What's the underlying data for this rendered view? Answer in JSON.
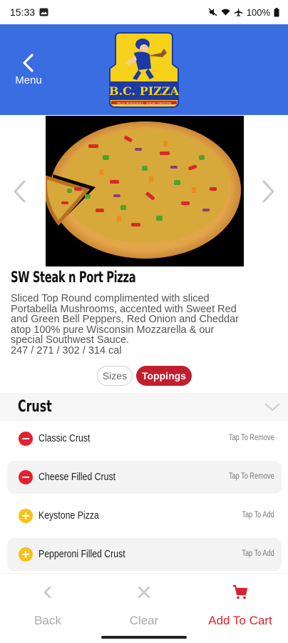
{
  "status_bar": {
    "time": "15:33",
    "battery": "100%"
  },
  "header": {
    "back_label": "Menu",
    "logo_text": "B.C. PIZZA",
    "logo_tagline": "FRESH INGREDIENTS · UNIQUE CREATIONS"
  },
  "product": {
    "title": "SW Steak n Port Pizza",
    "description": "Sliced Top Round complimented with sliced Portabella Mushrooms, accented with Sweet Red and Green Bell Peppers, Red Onion and Cheddar atop 100% pure Wisconsin Mozzarella & our special Southwest Sauce.",
    "calories": "247 / 271 / 302 / 314 cal"
  },
  "segments": {
    "sizes": "Sizes",
    "toppings": "Toppings",
    "selected": "Toppings"
  },
  "section": {
    "title": "Crust"
  },
  "options": [
    {
      "label": "Classic Crust",
      "action": "Tap To Remove",
      "state": "selected"
    },
    {
      "label": "Cheese Filled Crust",
      "action": "Tap To Remove",
      "state": "selected"
    },
    {
      "label": "Keystone Pizza",
      "action": "Tap To Add",
      "state": "available"
    },
    {
      "label": "Pepperoni Filled Crust",
      "action": "Tap To Add",
      "state": "available"
    }
  ],
  "bottom_bar": {
    "back": "Back",
    "clear": "Clear",
    "cart": "Add To Cart"
  },
  "colors": {
    "header_bg": "#3a6ee0",
    "accent_red": "#c21f2e",
    "remove_red": "#e5202f",
    "add_yellow": "#f6c21a"
  }
}
